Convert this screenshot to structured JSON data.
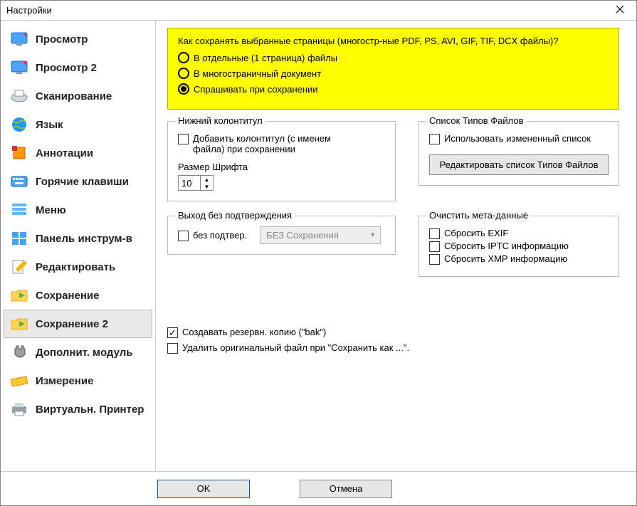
{
  "title": "Настройки",
  "sidebar": [
    {
      "label": "Просмотр"
    },
    {
      "label": "Просмотр 2"
    },
    {
      "label": "Сканирование"
    },
    {
      "label": "Язык"
    },
    {
      "label": "Аннотации"
    },
    {
      "label": "Горячие клавиши"
    },
    {
      "label": "Меню"
    },
    {
      "label": "Панель инструм-в"
    },
    {
      "label": "Редактировать"
    },
    {
      "label": "Сохранение"
    },
    {
      "label": "Сохранение 2"
    },
    {
      "label": "Дополнит. модуль"
    },
    {
      "label": "Измерение"
    },
    {
      "label": "Виртуальн. Принтер"
    }
  ],
  "yellow": {
    "question": "Как сохранять выбранные страницы (многостр-ные PDF, PS, AVI, GIF, TIF, DCX файлы)?",
    "opt1": "В отдельные (1 страница) файлы",
    "opt2": "В многостраничный документ",
    "opt3": "Спрашивать при сохранении"
  },
  "footer": {
    "legend": "Нижний колонтитул",
    "add_label": "Добавить колонтитул (с именем файла) при сохранении",
    "fontsize_label": "Размер Шрифта",
    "fontsize_value": "10"
  },
  "filetypes": {
    "legend": "Список Типов Файлов",
    "use_changed": "Использовать измененный список",
    "edit_btn": "Редактировать список Типов Файлов"
  },
  "exit": {
    "legend": "Выход без подтверждения",
    "noconfirm": "без подтвер.",
    "dropdown": "БЕЗ Сохранения"
  },
  "meta": {
    "legend": "Очистить мета-данные",
    "exif": "Сбросить EXIF",
    "iptc": "Сбросить IPTC информацию",
    "xmp": "Сбросить XMP информацию"
  },
  "extra": {
    "backup": "Создавать резервн. копию (\"bak\")",
    "delete_original": "Удалить оригинальный файл при \"Сохранить как ...\"."
  },
  "buttons": {
    "ok": "OK",
    "cancel": "Отмена"
  }
}
